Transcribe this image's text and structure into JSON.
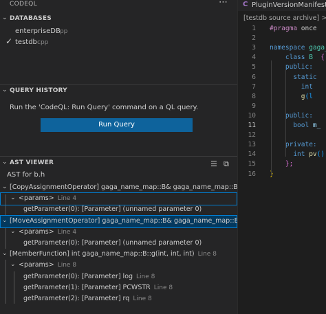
{
  "sidebar": {
    "view_title": "CODEQL",
    "more_icon": "ellipsis-icon",
    "databases": {
      "title": "DATABASES",
      "items": [
        {
          "name": "enterpriseDB",
          "lang": "cpp",
          "selected": false
        },
        {
          "name": "testdb",
          "lang": "cpp",
          "selected": true
        }
      ]
    },
    "query_history": {
      "title": "QUERY HISTORY",
      "hint": "Run the 'CodeQL: Run Query' command on a QL query.",
      "run_button": "Run Query"
    },
    "ast_viewer": {
      "title": "AST VIEWER",
      "tool_icons": [
        "clear-all-icon",
        "collapse-all-icon"
      ],
      "ast_for": "AST for b.h",
      "rows": [
        {
          "text": "[CopyAssignmentOperator] gaga_name_map::B& gaga_name_map::B::o...",
          "line": ""
        },
        {
          "text": "<params>",
          "line": "Line 4"
        },
        {
          "text": "getParameter(0): [Parameter] (unnamed parameter 0)",
          "line": ""
        },
        {
          "text": "[MoveAssignmentOperator] gaga_name_map::B& gaga_name_map::B::o...",
          "line": ""
        },
        {
          "text": "<params>",
          "line": "Line 4"
        },
        {
          "text": "getParameter(0): [Parameter] (unnamed parameter 0)",
          "line": ""
        },
        {
          "text": "[MemberFunction] int gaga_name_map::B::g(int, int, int)",
          "line": "Line 8"
        },
        {
          "text": "<params>",
          "line": "Line 8"
        },
        {
          "text": "getParameter(0): [Parameter] log",
          "line": "Line 8"
        },
        {
          "text": "getParameter(1): [Parameter] PCWSTR",
          "line": "Line 8"
        },
        {
          "text": "getParameter(2): [Parameter] rq",
          "line": "Line 8"
        }
      ]
    }
  },
  "editor": {
    "tab_icon": "C",
    "tab_title": "PluginVersionManifest.h",
    "breadcrumb": "[testdb source archive] > C_",
    "lines": [
      {
        "num": "1",
        "tokens": [
          {
            "t": "#pragma",
            "c": "k-pre"
          },
          {
            "t": " once",
            "c": "k-id"
          }
        ]
      },
      {
        "num": "2",
        "tokens": []
      },
      {
        "num": "3",
        "tokens": [
          {
            "t": "namespace",
            "c": "k-key"
          },
          {
            "t": " gaga_",
            "c": "k-type"
          }
        ]
      },
      {
        "num": "4",
        "tokens": [
          {
            "t": "    class",
            "c": "k-key"
          },
          {
            "t": " B ",
            "c": "k-type"
          },
          {
            "t": " {",
            "c": "k-brace2"
          }
        ]
      },
      {
        "num": "5",
        "tokens": [
          {
            "t": "    public:",
            "c": "k-key"
          }
        ]
      },
      {
        "num": "6",
        "tokens": [
          {
            "t": "      static",
            "c": "k-key"
          }
        ]
      },
      {
        "num": "7",
        "tokens": [
          {
            "t": "        int",
            "c": "k-key"
          }
        ]
      },
      {
        "num": "8",
        "tokens": [
          {
            "t": "        g",
            "c": "k-func"
          },
          {
            "t": "(l",
            "c": "k-paren"
          }
        ]
      },
      {
        "num": "9",
        "tokens": []
      },
      {
        "num": "10",
        "tokens": [
          {
            "t": "    public:",
            "c": "k-key"
          }
        ]
      },
      {
        "num": "11",
        "tokens": [
          {
            "t": "      bool",
            "c": "k-key"
          },
          {
            "t": " m_",
            "c": "k-var"
          }
        ]
      },
      {
        "num": "12",
        "tokens": []
      },
      {
        "num": "13",
        "tokens": [
          {
            "t": "    private:",
            "c": "k-key"
          }
        ]
      },
      {
        "num": "14",
        "tokens": [
          {
            "t": "      int",
            "c": "k-key"
          },
          {
            "t": " pv",
            "c": "k-func"
          },
          {
            "t": "(",
            "c": "k-paren"
          },
          {
            "t": ")",
            "c": "k-paren"
          },
          {
            "t": ";",
            "c": "k-id"
          }
        ]
      },
      {
        "num": "15",
        "tokens": [
          {
            "t": "    };",
            "c": "k-brace2"
          }
        ]
      },
      {
        "num": "16",
        "tokens": [
          {
            "t": "}",
            "c": "k-brace"
          }
        ]
      }
    ]
  }
}
